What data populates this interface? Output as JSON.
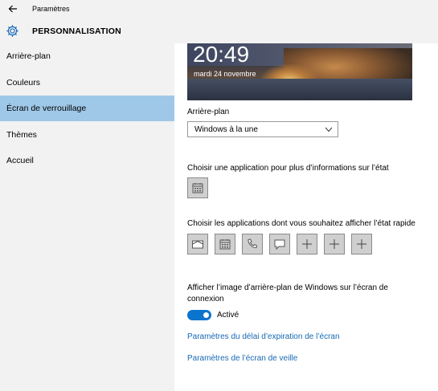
{
  "window": {
    "title": "Paramètres"
  },
  "header": {
    "title": "PERSONNALISATION"
  },
  "sidebar": {
    "items": [
      {
        "label": "Arrière-plan",
        "selected": false
      },
      {
        "label": "Couleurs",
        "selected": false
      },
      {
        "label": "Écran de verrouillage",
        "selected": true
      },
      {
        "label": "Thèmes",
        "selected": false
      },
      {
        "label": "Accueil",
        "selected": false
      }
    ]
  },
  "preview": {
    "time": "20:49",
    "date": "mardi 24 novembre"
  },
  "background": {
    "label": "Arrière-plan",
    "selected": "Windows à la une"
  },
  "detailed_status": {
    "label": "Choisir une application pour plus d’informations sur l’état",
    "apps": [
      "calendar-icon"
    ]
  },
  "quick_status": {
    "label": "Choisir les applications dont vous souhaitez afficher l’état rapide",
    "apps": [
      "mail-icon",
      "calendar-icon",
      "phone-icon",
      "message-icon",
      "plus-icon",
      "plus-icon",
      "plus-icon"
    ]
  },
  "signin_background": {
    "label": "Afficher l’image d’arrière-plan de Windows sur l’écran de connexion",
    "toggle_state": "Activé",
    "on": true
  },
  "links": {
    "timeout": "Paramètres du délai d’expiration de l’écran",
    "screensaver": "Paramètres de l’écran de veille"
  },
  "colors": {
    "accent": "#0a74cf",
    "selection": "#9fc8e8",
    "link": "#1769b4",
    "pane": "#f2f2f2"
  }
}
